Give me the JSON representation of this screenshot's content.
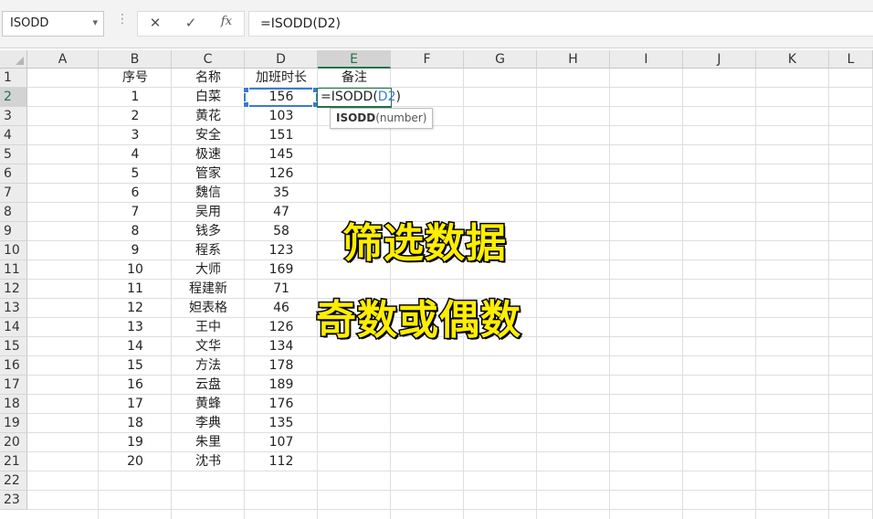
{
  "formula_bar": {
    "name_box": "ISODD",
    "name_box_arrow": "▾",
    "separator": "⋮",
    "cancel_icon": "✕",
    "enter_icon": "✓",
    "function_icon": "fx",
    "formula": "=ISODD(D2)"
  },
  "columns": [
    "A",
    "B",
    "C",
    "D",
    "E",
    "F",
    "G",
    "H",
    "I",
    "J",
    "K",
    "L"
  ],
  "active_column": "E",
  "active_row": 2,
  "rows": [
    "1",
    "2",
    "3",
    "4",
    "5",
    "6",
    "7",
    "8",
    "9",
    "10",
    "11",
    "12",
    "13",
    "14",
    "15",
    "16",
    "17",
    "18",
    "19",
    "20",
    "21",
    "22",
    "23"
  ],
  "headers": {
    "b": "序号",
    "c": "名称",
    "d": "加班时长",
    "e": "备注"
  },
  "table": [
    {
      "b": "1",
      "c": "白菜",
      "d": "156"
    },
    {
      "b": "2",
      "c": "黄花",
      "d": "103"
    },
    {
      "b": "3",
      "c": "安全",
      "d": "151"
    },
    {
      "b": "4",
      "c": "极速",
      "d": "145"
    },
    {
      "b": "5",
      "c": "管家",
      "d": "126"
    },
    {
      "b": "6",
      "c": "魏信",
      "d": "35"
    },
    {
      "b": "7",
      "c": "吴用",
      "d": "47"
    },
    {
      "b": "8",
      "c": "钱多",
      "d": "58"
    },
    {
      "b": "9",
      "c": "程系",
      "d": "123"
    },
    {
      "b": "10",
      "c": "大师",
      "d": "169"
    },
    {
      "b": "11",
      "c": "程建新",
      "d": "71"
    },
    {
      "b": "12",
      "c": "妲表格",
      "d": "46"
    },
    {
      "b": "13",
      "c": "王中",
      "d": "126"
    },
    {
      "b": "14",
      "c": "文华",
      "d": "134"
    },
    {
      "b": "15",
      "c": "方法",
      "d": "178"
    },
    {
      "b": "16",
      "c": "云盘",
      "d": "189"
    },
    {
      "b": "17",
      "c": "黄蜂",
      "d": "176"
    },
    {
      "b": "18",
      "c": "李典",
      "d": "135"
    },
    {
      "b": "19",
      "c": "朱里",
      "d": "107"
    },
    {
      "b": "20",
      "c": "沈书",
      "d": "112"
    }
  ],
  "editing_cell": {
    "prefix": "=ISODD(",
    "ref": "D2",
    "suffix": ")"
  },
  "tooltip": {
    "fn": "ISODD",
    "args": "(number)"
  },
  "captions": {
    "line1": "筛选数据",
    "line2": "奇数或偶数"
  },
  "colors": {
    "caption_fill": "#ffee00",
    "caption_stroke": "#000000",
    "selection": "#3a7bd5",
    "excel_green": "#217346"
  }
}
